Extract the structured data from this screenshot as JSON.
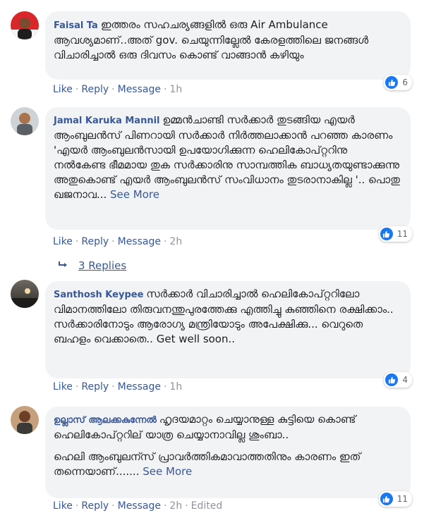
{
  "comments": [
    {
      "author": "Faisal Ta",
      "text": "ഇത്തരം സഹചര്യങ്ങളിൽ ഒരു Air Ambulance ആവശ്യമാണ്..അത് gov. ചെയുന്നില്ലേൽ കേരളത്തിലെ ജനങ്ങൾ വിചാരിച്ചാൽ ഒരു ദിവസം കൊണ്ട് വാങ്ങാൻ കഴിയും",
      "actions": {
        "like": "Like",
        "reply": "Reply",
        "message": "Message",
        "time": "1h"
      },
      "reaction_count": "6"
    },
    {
      "author": "Jamal Karuka Mannil",
      "text": "ഉമ്മൻചാണ്ടി സർക്കാർ തുടങ്ങിയ എയർ ആംബുലൻസ് പിണറായി സർക്കാർ നിർത്തലാക്കാൻ പറഞ്ഞ കാരണം 'എയർ ആംബുലൻസായി ഉപയോഗിക്കുന്ന ഹെലികോപ്റ്ററിനു നൽകേണ്ട ഭീമമായ തുക സർക്കാരിനു സാമ്പത്തിക ബാധ്യതയുണ്ടാക്കുന്നു അതുകൊണ്ട് എയർ ആംബുലൻസ് സംവിധാനം തുടരാനാകില്ല '.. പൊതു ഖജനാവ...",
      "see_more": "See More",
      "actions": {
        "like": "Like",
        "reply": "Reply",
        "message": "Message",
        "time": "2h"
      },
      "reaction_count": "11",
      "replies_label": "3 Replies"
    },
    {
      "author": "Santhosh Keypee",
      "text": "സർക്കാർ വിചാരിച്ചാൽ ഹെലികോപ്റ്ററിലോ വിമാനത്തിലോ തിരുവനന്തുപുരത്തേക്കു എത്തിച്ചു കുഞ്ഞിനെ രക്ഷിക്കാം.. സർക്കാരിനോടും ആരോഗ്യ മന്ത്രിയോടും അപേക്ഷിക്കു... വെറുതെ ബഹളം വെക്കാതെ.. Get well soon..",
      "actions": {
        "like": "Like",
        "reply": "Reply",
        "message": "Message",
        "time": "1h"
      },
      "reaction_count": "4"
    },
    {
      "author": "ഉല്ലാസ് ആലക്കകുന്നേൽ",
      "text": "ഹൃദയമാറ്റം ചെയ്യാനുള്ള കുട്ടിയെ കൊണ്ട് ഹെലികോപ്റ്ററില് യാത്ര ചെയ്യാനാവില്ല ശുംബാ..",
      "text2": "ഹെലി ആംബുലന്സ് പ്രാവർത്തികമാവാത്തതിനും കാരണം ഇത് തന്നെയാണ്.......",
      "see_more": "See More",
      "actions": {
        "like": "Like",
        "reply": "Reply",
        "message": "Message",
        "time": "2h",
        "edited": "Edited"
      },
      "reaction_count": "11"
    }
  ],
  "colors": {
    "link": "#385898",
    "bubble": "#f2f3f5",
    "like_blue": "#1877f2"
  },
  "icons": {
    "reaction": "thumbs-up-icon",
    "reply_arrow": "reply-arrow-icon"
  }
}
